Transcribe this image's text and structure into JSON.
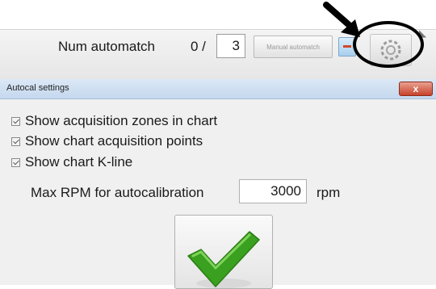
{
  "toolbar": {
    "num_automatch_label": "Num automatch",
    "num_automatch_value": "0 /",
    "num_automatch_total": "3",
    "manual_automatch_label": "Manual automatch"
  },
  "dialog": {
    "title": "Autocal settings",
    "close_label": "x",
    "options": [
      {
        "label": "Show acquisition zones in chart",
        "checked": true
      },
      {
        "label": "Show chart acquisition points",
        "checked": true
      },
      {
        "label": "Show chart K-line",
        "checked": true
      }
    ],
    "max_rpm_label": "Max RPM for autocalibration",
    "max_rpm_value": "3000",
    "max_rpm_unit": "rpm"
  },
  "icons": {
    "pointer": "arrow-pointer-icon",
    "highlight": "highlight-circle",
    "settings": "gear-icon",
    "confirm": "green-check-icon"
  },
  "colors": {
    "close_button": "#c8432b",
    "check_mark": "#3aa01f",
    "titlebar": "#c5d8ee"
  }
}
